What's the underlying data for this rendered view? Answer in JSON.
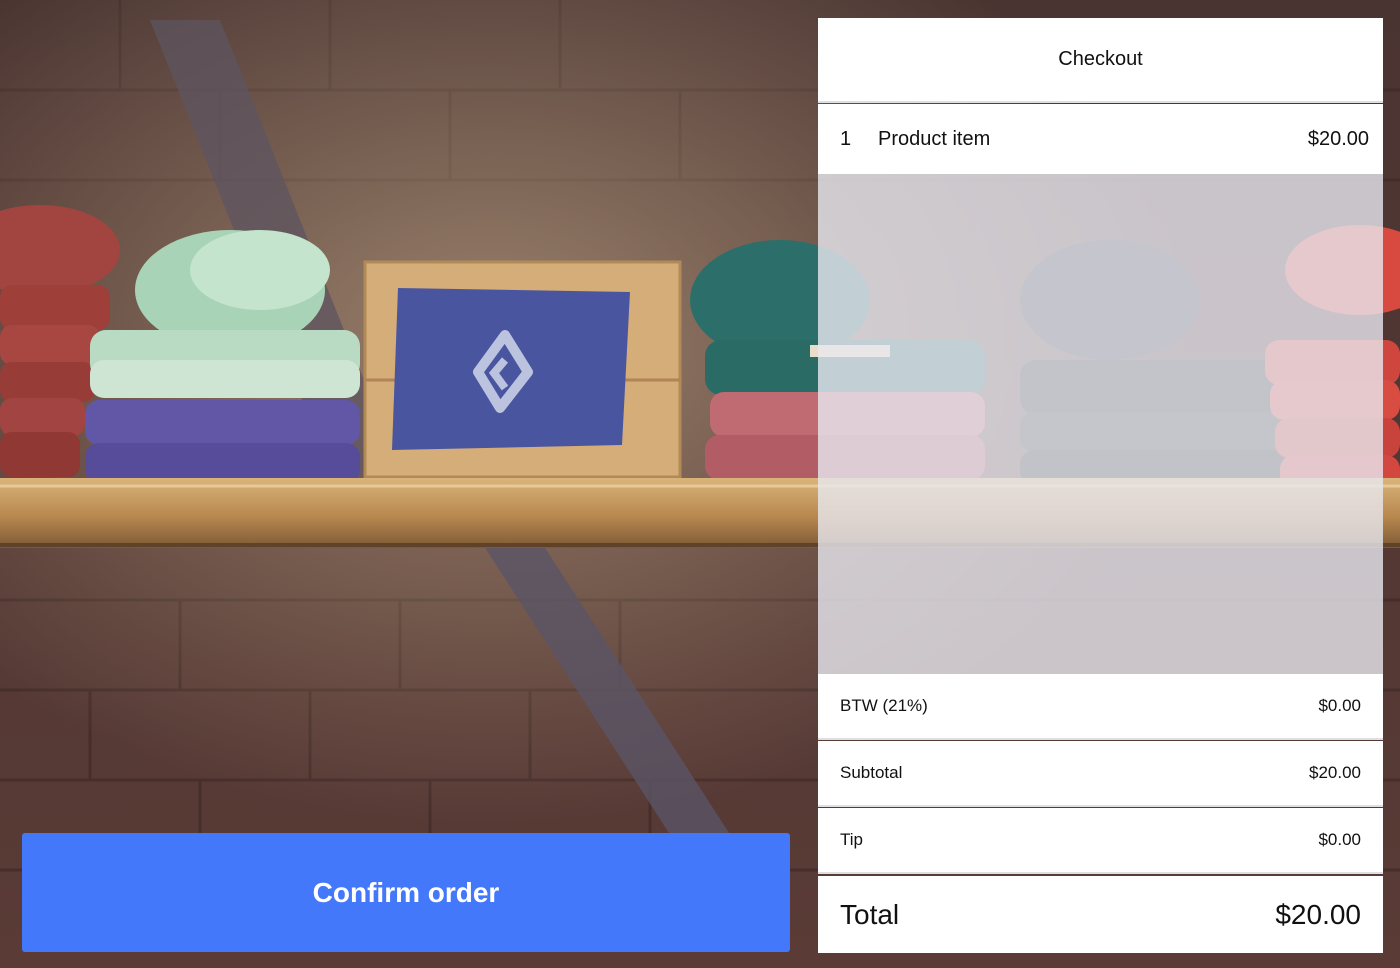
{
  "checkout": {
    "title": "Checkout",
    "items": [
      {
        "quantity": "1",
        "name": "Product item",
        "price": "$20.00"
      }
    ],
    "summary": {
      "tax_label": "BTW (21%)",
      "tax_value": "$0.00",
      "subtotal_label": "Subtotal",
      "subtotal_value": "$20.00",
      "tip_label": "Tip",
      "tip_value": "$0.00"
    },
    "total": {
      "label": "Total",
      "value": "$20.00"
    }
  },
  "actions": {
    "confirm_label": "Confirm order"
  },
  "colors": {
    "accent": "#4478fb",
    "panel_background": "#ffffff",
    "divider": "#dedee3",
    "text": "#111111"
  },
  "background": {
    "subject": "folded clothes on a wooden shelf against a brick wall",
    "icon": "lightspeed-flame-logo-icon"
  }
}
